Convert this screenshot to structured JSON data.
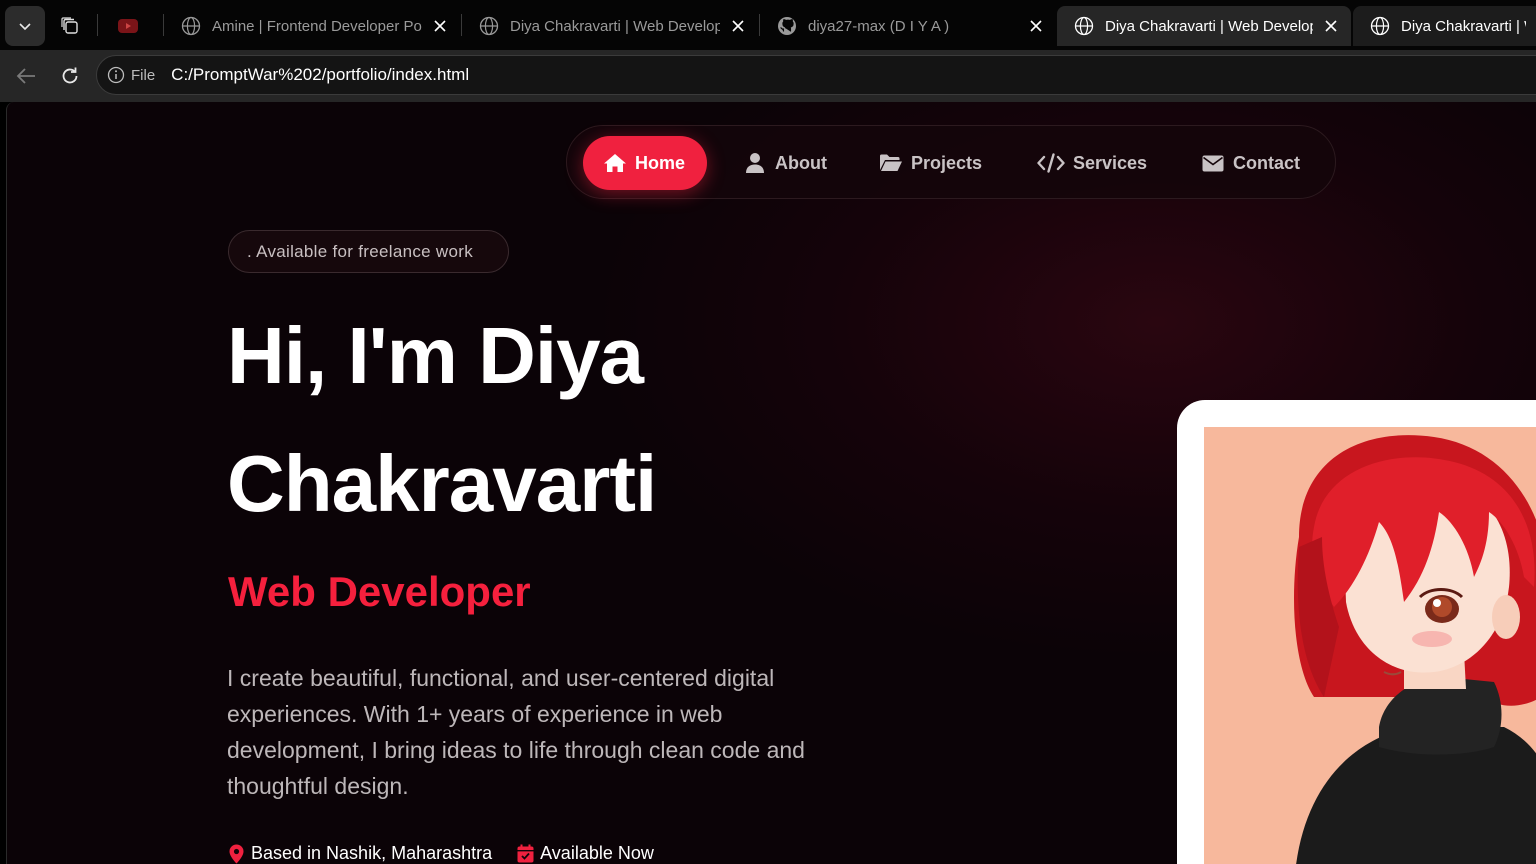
{
  "browser": {
    "tabs": [
      {
        "title": "",
        "icon": "youtube-icon",
        "active": false
      },
      {
        "title": "Amine | Frontend Developer Portfolio",
        "icon": "globe-icon",
        "active": false
      },
      {
        "title": "Diya Chakravarti | Web Developer",
        "icon": "globe-icon",
        "active": false
      },
      {
        "title": "diya27-max (D I Y A )",
        "icon": "github-icon",
        "active": false
      },
      {
        "title": "Diya Chakravarti | Web Developer",
        "icon": "globe-icon",
        "active": true
      },
      {
        "title": "Diya Chakravarti | Web Developer",
        "icon": "globe-icon",
        "active": false
      }
    ],
    "site_info_label": "File",
    "url": "C:/PromptWar%202/portfolio/index.html"
  },
  "nav": {
    "items": [
      {
        "label": "Home",
        "icon": "home-icon",
        "active": true
      },
      {
        "label": "About",
        "icon": "user-icon",
        "active": false
      },
      {
        "label": "Projects",
        "icon": "folder-icon",
        "active": false
      },
      {
        "label": "Services",
        "icon": "code-icon",
        "active": false
      },
      {
        "label": "Contact",
        "icon": "envelope-icon",
        "active": false
      }
    ]
  },
  "hero": {
    "badge": ". Available for freelance work",
    "title_line1": "Hi, I'm Diya",
    "title_line2": "Chakravarti",
    "role": "Web Developer",
    "description": "I create beautiful, functional, and user-centered digital experiences. With 1+ years of experience in web development, I bring ideas to life through clean code and thoughtful design.",
    "location": "Based in Nashik, Maharashtra",
    "availability": "Available Now"
  },
  "colors": {
    "accent": "#f0213f",
    "background": "#0b0307",
    "text_muted": "#bdb7b9"
  }
}
